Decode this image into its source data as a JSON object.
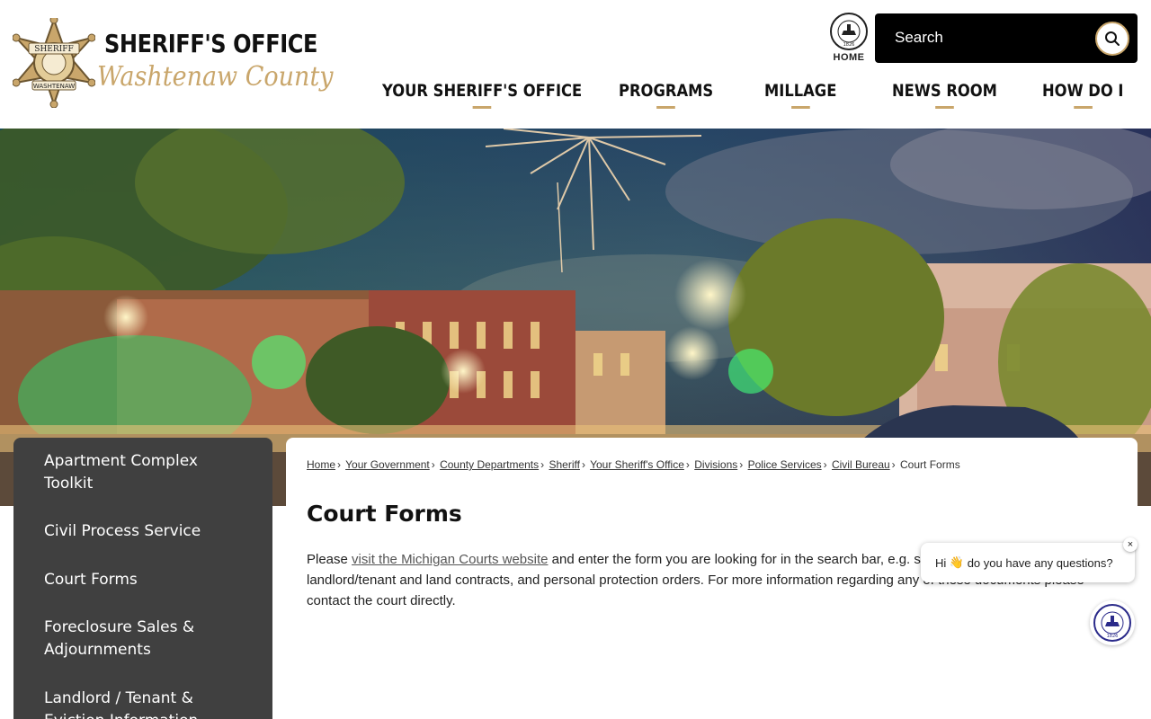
{
  "header": {
    "logo": {
      "title_line": "SHERIFF'S OFFICE",
      "subtitle_line": "Washtenaw County",
      "badge_text_top": "SHERIFF",
      "badge_text_bottom": "WASHTENAW"
    },
    "home": {
      "label": "HOME",
      "seal_text": "WASHTENAW COUNTY MICHIGAN 1826"
    },
    "search": {
      "placeholder": "Search"
    },
    "nav": [
      {
        "label": "YOUR SHERIFF'S OFFICE"
      },
      {
        "label": "PROGRAMS"
      },
      {
        "label": "MILLAGE"
      },
      {
        "label": "NEWS ROOM"
      },
      {
        "label": "HOW DO I"
      }
    ]
  },
  "sidebar": {
    "items": [
      {
        "label": "Apartment Complex Toolkit"
      },
      {
        "label": "Civil Process Service"
      },
      {
        "label": "Court Forms"
      },
      {
        "label": "Foreclosure Sales & Adjournments"
      },
      {
        "label": "Landlord / Tenant & Eviction Information"
      }
    ]
  },
  "breadcrumb": [
    {
      "label": "Home"
    },
    {
      "label": "Your Government"
    },
    {
      "label": "County Departments"
    },
    {
      "label": "Sheriff"
    },
    {
      "label": "Your Sheriff's Office"
    },
    {
      "label": "Divisions"
    },
    {
      "label": "Police Services"
    },
    {
      "label": "Civil Bureau"
    },
    {
      "label": "Court Forms"
    }
  ],
  "main": {
    "title": "Court Forms",
    "text_before_link": "Please ",
    "link_text": "visit the Michigan Courts website",
    "text_after_link": " and enter the form you are looking for in the search bar, e.g. small claims, garnishments, landlord/tenant and land contracts, and personal protection orders. For more information regarding any of these documents please contact the court directly."
  },
  "chat": {
    "greeting_prefix": "Hi ",
    "greeting_emoji": "👋",
    "greeting_suffix": " do you have any questions?",
    "close_label": "×"
  },
  "colors": {
    "accent_gold": "#c9a66b",
    "sidebar_bg": "#404040",
    "search_bg": "#000000"
  },
  "icons": {
    "search": "search-icon",
    "seal": "county-seal-icon",
    "badge": "sheriff-star-badge-icon",
    "close": "close-icon"
  }
}
